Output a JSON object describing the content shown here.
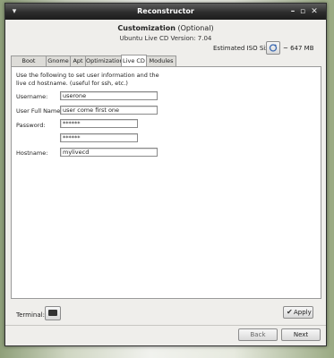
{
  "window": {
    "title": "Reconstructor"
  },
  "header": {
    "title": "Customization",
    "title_suffix": "(Optional)",
    "subtitle": "Ubuntu Live CD Version: 7.04",
    "iso_size_label": "Estimated ISO Size:",
    "iso_size_value": "~ 647 MB"
  },
  "tabs": [
    {
      "label": "Boot Screen",
      "active": false
    },
    {
      "label": "Gnome",
      "active": false
    },
    {
      "label": "Apt",
      "active": false
    },
    {
      "label": "Optimization",
      "active": false
    },
    {
      "label": "Live CD",
      "active": true
    },
    {
      "label": "Modules",
      "active": false
    }
  ],
  "livecd": {
    "intro": "Use the following to set user information and the live cd hostname. (useful for ssh, etc.)",
    "username_label": "Username:",
    "username_value": "userone",
    "fullname_label": "User Full Name:",
    "fullname_value": "user come first one",
    "password_label": "Password:",
    "password_value": "******",
    "password_confirm_value": "******",
    "hostname_label": "Hostname:",
    "hostname_value": "mylivecd"
  },
  "footer": {
    "terminal_label": "Terminal:",
    "apply_label": "Apply",
    "back_label": "Back",
    "next_label": "Next"
  }
}
